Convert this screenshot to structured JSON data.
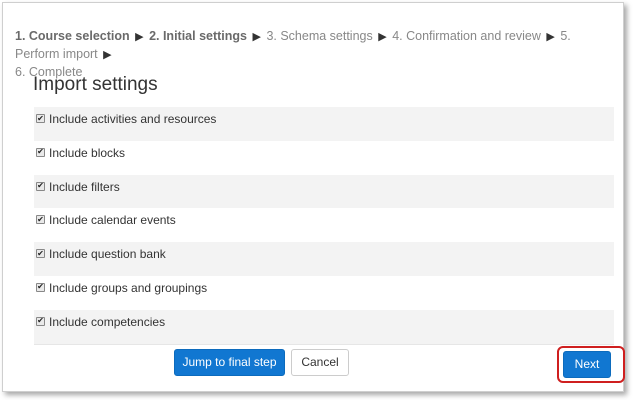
{
  "breadcrumb": {
    "steps": [
      {
        "label": "1. Course selection"
      },
      {
        "label": "2. Initial settings"
      },
      {
        "label": "3. Schema settings"
      },
      {
        "label": "4. Confirmation and review"
      },
      {
        "label": "5. Perform import"
      },
      {
        "label": "6. Complete"
      }
    ],
    "separator": "▶"
  },
  "section": {
    "title": "Import settings"
  },
  "options": [
    {
      "label": "Include activities and resources",
      "checked": true
    },
    {
      "label": "Include blocks",
      "checked": true
    },
    {
      "label": "Include filters",
      "checked": true
    },
    {
      "label": "Include calendar events",
      "checked": true
    },
    {
      "label": "Include question bank",
      "checked": true
    },
    {
      "label": "Include groups and groupings",
      "checked": true
    },
    {
      "label": "Include competencies",
      "checked": true
    }
  ],
  "checkmark": "✔",
  "buttons": {
    "jump_label": "Jump to final step",
    "cancel_label": "Cancel",
    "next_label": "Next"
  },
  "colors": {
    "primary": "#1177d1",
    "highlight": "#cf1f1f",
    "row_shade": "#f3f3f3"
  }
}
